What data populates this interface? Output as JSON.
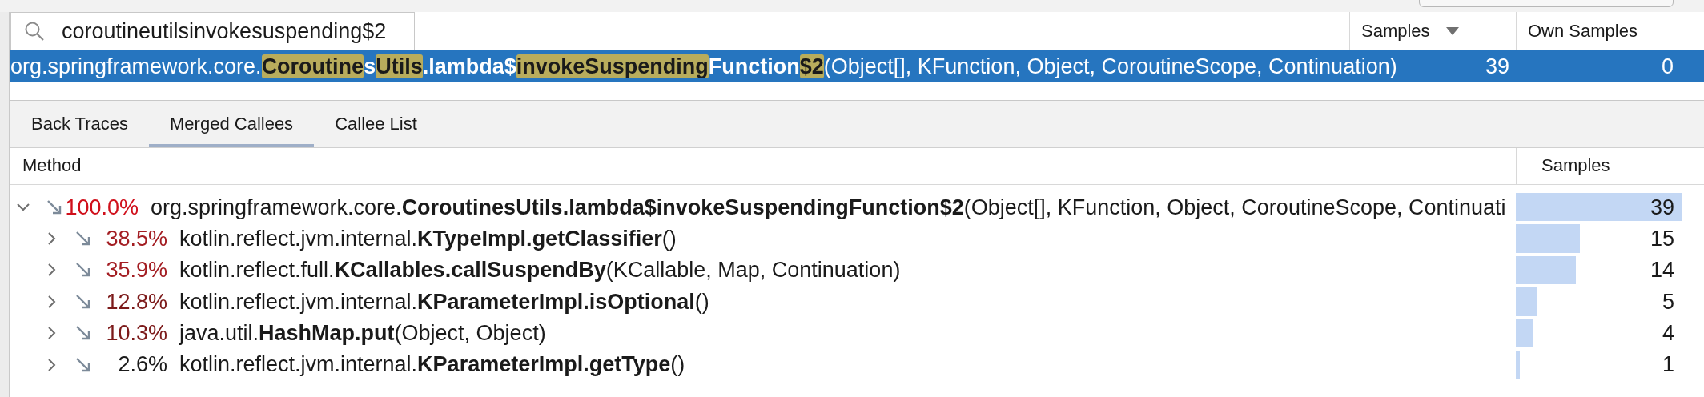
{
  "search": {
    "value": "coroutineutilsinvokesuspending$2"
  },
  "results": {
    "columns": [
      {
        "label": "Samples",
        "sorted": true
      },
      {
        "label": "Own Samples",
        "sorted": false
      }
    ],
    "rows": [
      {
        "selected": true,
        "method": [
          {
            "text": "org.springframework.core.",
            "bold": false,
            "match": false
          },
          {
            "text": "Coroutine",
            "bold": true,
            "match": true
          },
          {
            "text": "s",
            "bold": true,
            "match": false
          },
          {
            "text": "Utils",
            "bold": true,
            "match": true
          },
          {
            "text": ".lambda$",
            "bold": true,
            "match": false
          },
          {
            "text": "invokeSuspending",
            "bold": true,
            "match": true
          },
          {
            "text": "Function",
            "bold": true,
            "match": false
          },
          {
            "text": "$2",
            "bold": true,
            "match": true
          },
          {
            "text": "(Object[], KFunction, Object, CoroutineScope, Continuation)",
            "bold": false,
            "match": false
          }
        ],
        "samples": "39",
        "own_samples": "0"
      }
    ]
  },
  "tabs": [
    {
      "label": "Back Traces",
      "selected": false
    },
    {
      "label": "Merged Callees",
      "selected": true
    },
    {
      "label": "Callee List",
      "selected": false
    }
  ],
  "tree": {
    "columns": [
      "Method",
      "Samples"
    ],
    "rows": [
      {
        "percent": "100.0%",
        "color": "#d0101b",
        "method": "org.springframework.core.**CoroutinesUtils.lambda$invokeSuspendingFunction$2**(Object[], KFunction, Object, CoroutineScope, Continuati",
        "samples": "39",
        "expanded": true,
        "children": [
          {
            "percent": "38.5%",
            "color": "#a31d22",
            "method": "kotlin.reflect.jvm.internal.**KTypeImpl.getClassifier**()",
            "samples": "15",
            "expanded": false
          },
          {
            "percent": "35.9%",
            "color": "#a31d22",
            "method": "kotlin.reflect.full.**KCallables.callSuspendBy**(KCallable, Map, Continuation)",
            "samples": "14",
            "expanded": false
          },
          {
            "percent": "12.8%",
            "color": "#7c1a1a",
            "method": "kotlin.reflect.jvm.internal.**KParameterImpl.isOptional**()",
            "samples": "5",
            "expanded": false
          },
          {
            "percent": "10.3%",
            "color": "#7c1a1a",
            "method": "java.util.**HashMap.put**(Object, Object)",
            "samples": "4",
            "expanded": false
          },
          {
            "percent": "2.6%",
            "color": "#1a1a1a",
            "method": "kotlin.reflect.jvm.internal.**KParameterImpl.getType**()",
            "samples": "1",
            "expanded": false
          }
        ]
      }
    ]
  }
}
